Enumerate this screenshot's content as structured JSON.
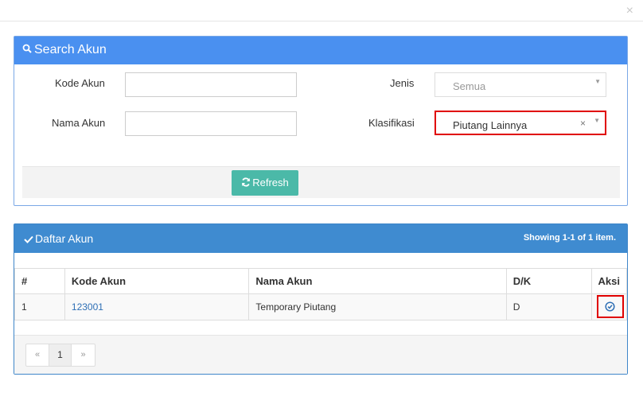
{
  "modal": {
    "close_symbol": "×"
  },
  "search_panel": {
    "title": "Search Akun",
    "icon": "search-icon",
    "fields": {
      "kode_akun_label": "Kode Akun",
      "kode_akun_value": "",
      "nama_akun_label": "Nama Akun",
      "nama_akun_value": "",
      "jenis_label": "Jenis",
      "jenis_value": "Semua",
      "klasifikasi_label": "Klasifikasi",
      "klasifikasi_value": "Piutang Lainnya",
      "clear_symbol": "×",
      "caret_symbol": "▼"
    },
    "refresh_label": "Refresh",
    "refresh_icon": "refresh-icon",
    "colors": {
      "header": "#4a90f0",
      "refresh_button": "#4bb9a8"
    }
  },
  "list_panel": {
    "title": "Daftar Akun",
    "icon": "check-icon",
    "summary": {
      "prefix": "Showing ",
      "range": "1-1",
      "mid": " of ",
      "total": "1",
      "suffix": " item."
    },
    "columns": [
      "#",
      "Kode Akun",
      "Nama Akun",
      "D/K",
      "Aksi"
    ],
    "rows": [
      {
        "no": "1",
        "kode": "123001",
        "nama": "Temporary Piutang",
        "dk": "D",
        "aksi_icon": "select-check-circle-icon"
      }
    ],
    "pagination": {
      "prev": "«",
      "current": "1",
      "next": "»"
    },
    "colors": {
      "header": "#3f8bd0",
      "highlight": "#e00000"
    }
  }
}
